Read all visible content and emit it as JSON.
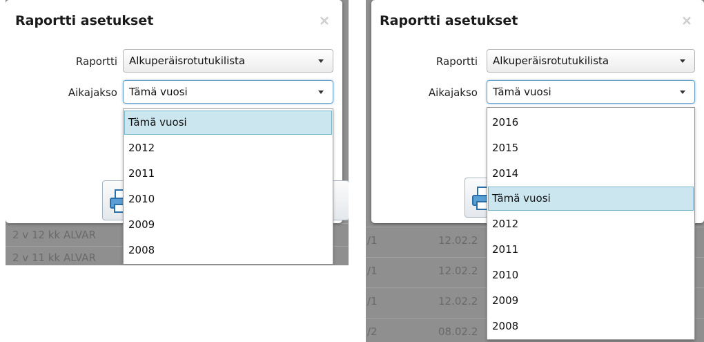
{
  "dialog": {
    "title": "Raportti asetukset"
  },
  "fields": {
    "report_label": "Raportti",
    "report_value": "Alkuperäisrotutukilista",
    "period_label": "Aikajakso",
    "period_value": "Tämä vuosi"
  },
  "left": {
    "dropdown_options": [
      "Tämä vuosi",
      "2012",
      "2011",
      "2010",
      "2009",
      "2008"
    ],
    "selected_option": "Tämä vuosi",
    "background_rows": [
      "2 v 12 kk  ALVAR",
      "2 v 11 kk  ALVAR"
    ]
  },
  "right": {
    "dropdown_options": [
      "2016",
      "2015",
      "2014",
      "Tämä vuosi",
      "2012",
      "2011",
      "2010",
      "2009",
      "2008"
    ],
    "selected_option": "Tämä vuosi",
    "background_rows": [
      {
        "col1": "/1",
        "col2": "12.02.2"
      },
      {
        "col1": "/1",
        "col2": "12.02.2"
      },
      {
        "col1": "/1",
        "col2": "12.02.2"
      },
      {
        "col1": "/2",
        "col2": "08.02.2"
      }
    ]
  },
  "icons": [
    "close-icon",
    "chevron-down-icon",
    "printer-icon"
  ],
  "colors": {
    "selected_highlight": "#cbe6ef",
    "selected_border": "#76b4cc",
    "focus_border": "#6aa0c8",
    "backdrop": "#8f8f8f"
  }
}
